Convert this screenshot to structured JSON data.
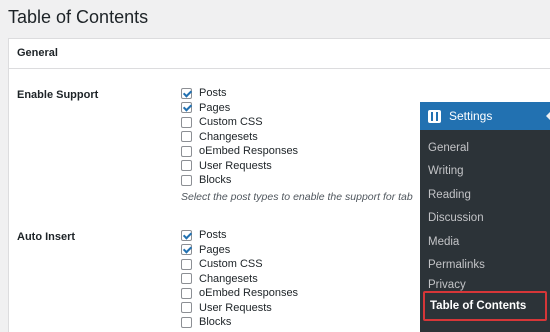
{
  "page": {
    "title": "Table of Contents"
  },
  "section": {
    "title": "General"
  },
  "enable_support": {
    "label": "Enable Support",
    "options": [
      {
        "label": "Posts",
        "checked": true
      },
      {
        "label": "Pages",
        "checked": true
      },
      {
        "label": "Custom CSS",
        "checked": false
      },
      {
        "label": "Changesets",
        "checked": false
      },
      {
        "label": "oEmbed Responses",
        "checked": false
      },
      {
        "label": "User Requests",
        "checked": false
      },
      {
        "label": "Blocks",
        "checked": false
      }
    ],
    "description": "Select the post types to enable the support for tab"
  },
  "auto_insert": {
    "label": "Auto Insert",
    "options": [
      {
        "label": "Posts",
        "checked": true
      },
      {
        "label": "Pages",
        "checked": true
      },
      {
        "label": "Custom CSS",
        "checked": false
      },
      {
        "label": "Changesets",
        "checked": false
      },
      {
        "label": "oEmbed Responses",
        "checked": false
      },
      {
        "label": "User Requests",
        "checked": false
      },
      {
        "label": "Blocks",
        "checked": false
      }
    ]
  },
  "admin_menu": {
    "header": "Settings",
    "header_icon": "settings-sliders-icon",
    "items": [
      "General",
      "Writing",
      "Reading",
      "Discussion",
      "Media",
      "Permalinks",
      "Privacy",
      "Table of Contents"
    ],
    "highlight_color": "#d63638",
    "accent_color": "#2271b1"
  }
}
